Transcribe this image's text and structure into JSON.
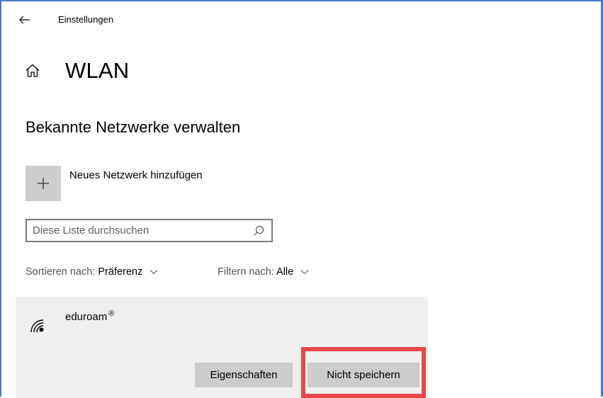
{
  "app": {
    "title": "Einstellungen"
  },
  "page": {
    "title": "WLAN"
  },
  "section": {
    "title": "Bekannte Netzwerke verwalten"
  },
  "add_network": {
    "label": "Neues Netzwerk hinzufügen"
  },
  "search": {
    "placeholder": "Diese Liste durchsuchen",
    "value": ""
  },
  "sort": {
    "label": "Sortieren nach:",
    "value": "Präferenz"
  },
  "filter": {
    "label": "Filtern nach:",
    "value": "Alle"
  },
  "networks": [
    {
      "name": "eduroam",
      "badge": "®",
      "buttons": {
        "properties": "Eigenschaften",
        "forget": "Nicht speichern"
      }
    }
  ],
  "icons": {
    "back": "arrow-left-icon",
    "home": "home-icon",
    "add": "plus-icon",
    "search": "search-icon",
    "chevron": "chevron-down-icon",
    "wifi": "wifi-secured-icon"
  },
  "colors": {
    "frame_border": "#4a78c2",
    "highlight": "#e5474a",
    "button_bg": "#cccccc",
    "item_bg": "#efefef",
    "add_tile_bg": "#cdcdcd"
  }
}
